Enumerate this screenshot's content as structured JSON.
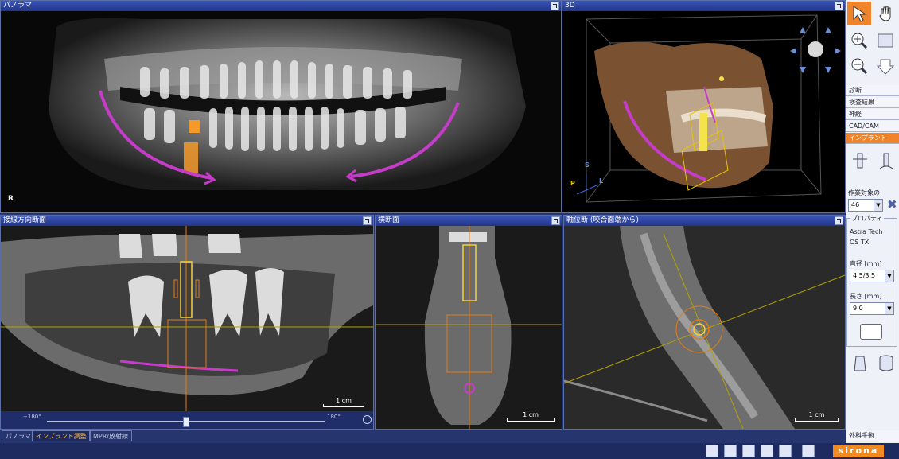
{
  "panels": {
    "panorama": {
      "title": "パノラマ",
      "side_marker": "R"
    },
    "view3d": {
      "title": "3D",
      "axis_s": "S",
      "axis_p": "P",
      "axis_l": "L"
    },
    "tangential": {
      "title": "接線方向断面",
      "scale": "1 cm",
      "slider_min": "−180°",
      "slider_max": "180°"
    },
    "cross": {
      "title": "横断面",
      "scale": "1 cm"
    },
    "axial": {
      "title": "軸位断 (咬合面端から)",
      "scale": "1 cm"
    }
  },
  "sidebar": {
    "menu": [
      "診断",
      "検査結果",
      "神経",
      "CAD/CAM",
      "インプラント"
    ],
    "active_menu": "インプラント",
    "target_label": "作業対象の",
    "target_value": "46",
    "properties_title": "プロパティ",
    "implant_brand": "Astra Tech",
    "implant_model": "OS TX",
    "diameter_label": "直径 [mm]",
    "diameter_value": "4.5/3.5",
    "length_label": "長さ [mm]",
    "length_value": "9.0",
    "surgical_label": "外科手術"
  },
  "tabs": {
    "t1": "パノラマ",
    "t2": "インプラント調整",
    "t3": "MPR/放射線"
  },
  "footer": {
    "brand": "sirona"
  },
  "colors": {
    "accent_orange": "#f0842a",
    "nerve_magenta": "#c43cc8",
    "implant_yellow": "#e8c400",
    "title_blue": "#2a40a0"
  }
}
